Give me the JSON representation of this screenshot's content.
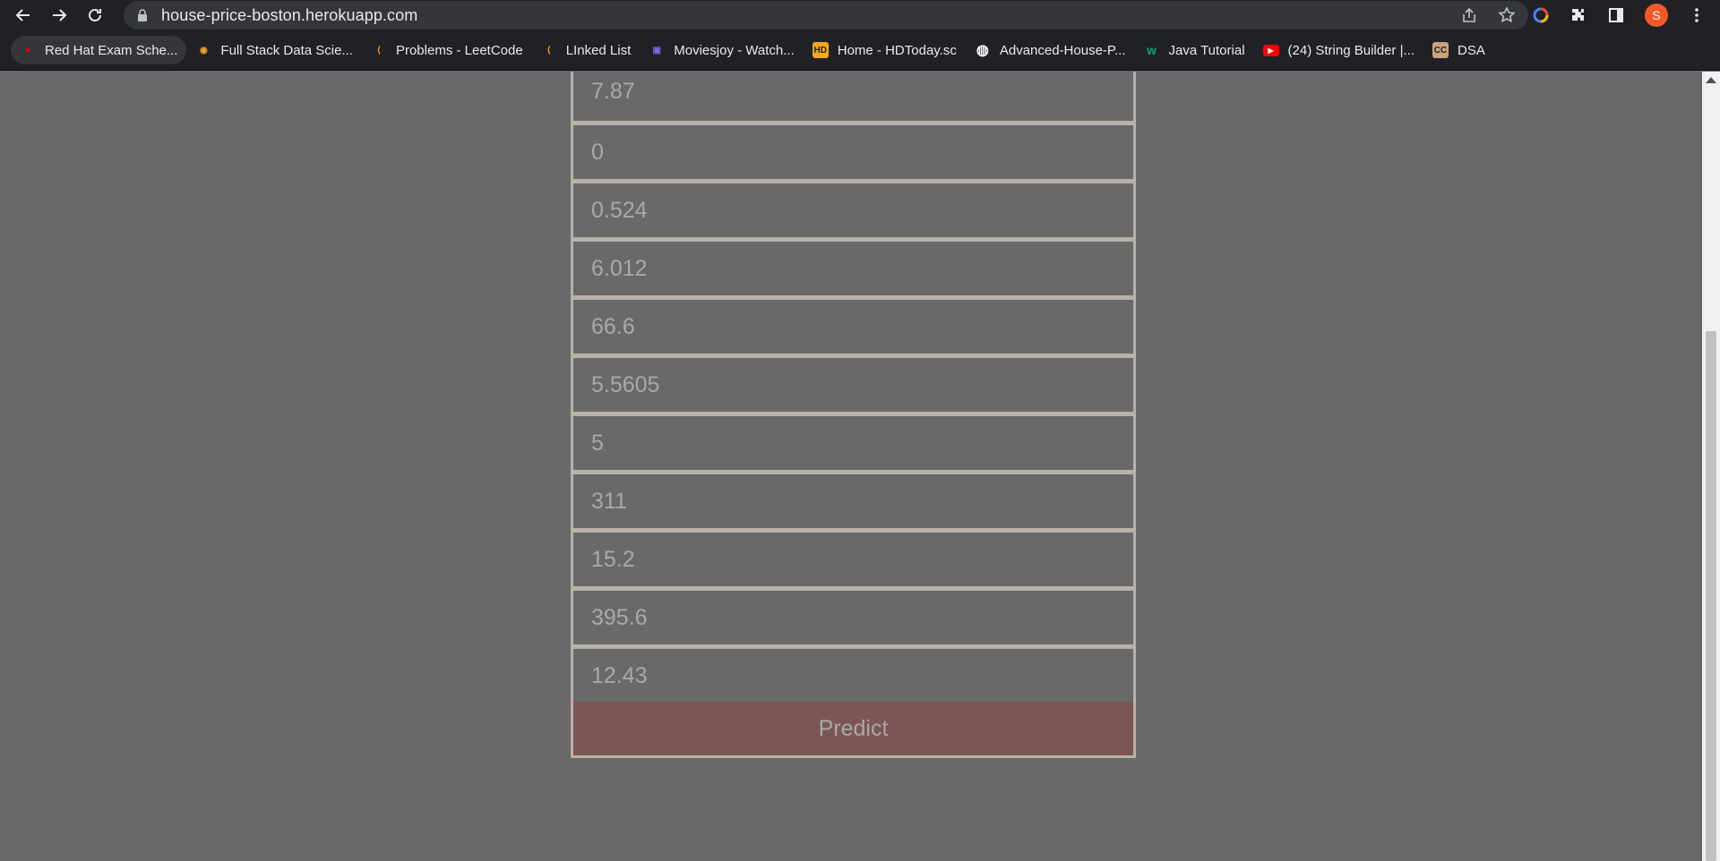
{
  "browser": {
    "url": "house-price-boston.herokuapp.com",
    "avatar_letter": "S",
    "bookmarks": [
      {
        "label": "Red Hat Exam Sche...",
        "icon": "redhat-icon",
        "color": "#ee0000"
      },
      {
        "label": "Full Stack Data Scie...",
        "icon": "datascience-icon",
        "color": "#f5a623"
      },
      {
        "label": "Problems - LeetCode",
        "icon": "leetcode-icon",
        "color": "#ffa116"
      },
      {
        "label": "LInked List",
        "icon": "leetcode-icon",
        "color": "#ffa116"
      },
      {
        "label": "Moviesjoy - Watch...",
        "icon": "moviesjoy-icon",
        "color": "#7b68ee"
      },
      {
        "label": "Home - HDToday.sc",
        "icon": "hd-icon",
        "color": "#f5a623"
      },
      {
        "label": "Advanced-House-P...",
        "icon": "github-icon",
        "color": "#ffffff"
      },
      {
        "label": "Java Tutorial",
        "icon": "w3schools-icon",
        "color": "#04aa6d"
      },
      {
        "label": "(24) String Builder |...",
        "icon": "youtube-icon",
        "color": "#ff0000"
      },
      {
        "label": "DSA",
        "icon": "cc-icon",
        "color": "#c9a47a"
      }
    ]
  },
  "form": {
    "fields": [
      "7.87",
      "0",
      "0.524",
      "6.012",
      "66.6",
      "5.5605",
      "5",
      "311",
      "15.2",
      "395.6",
      "12.43"
    ],
    "submit_label": "Predict"
  },
  "colors": {
    "page_background": "#696969",
    "field_border": "#b7b2aa",
    "button_background": "#7c5655"
  }
}
